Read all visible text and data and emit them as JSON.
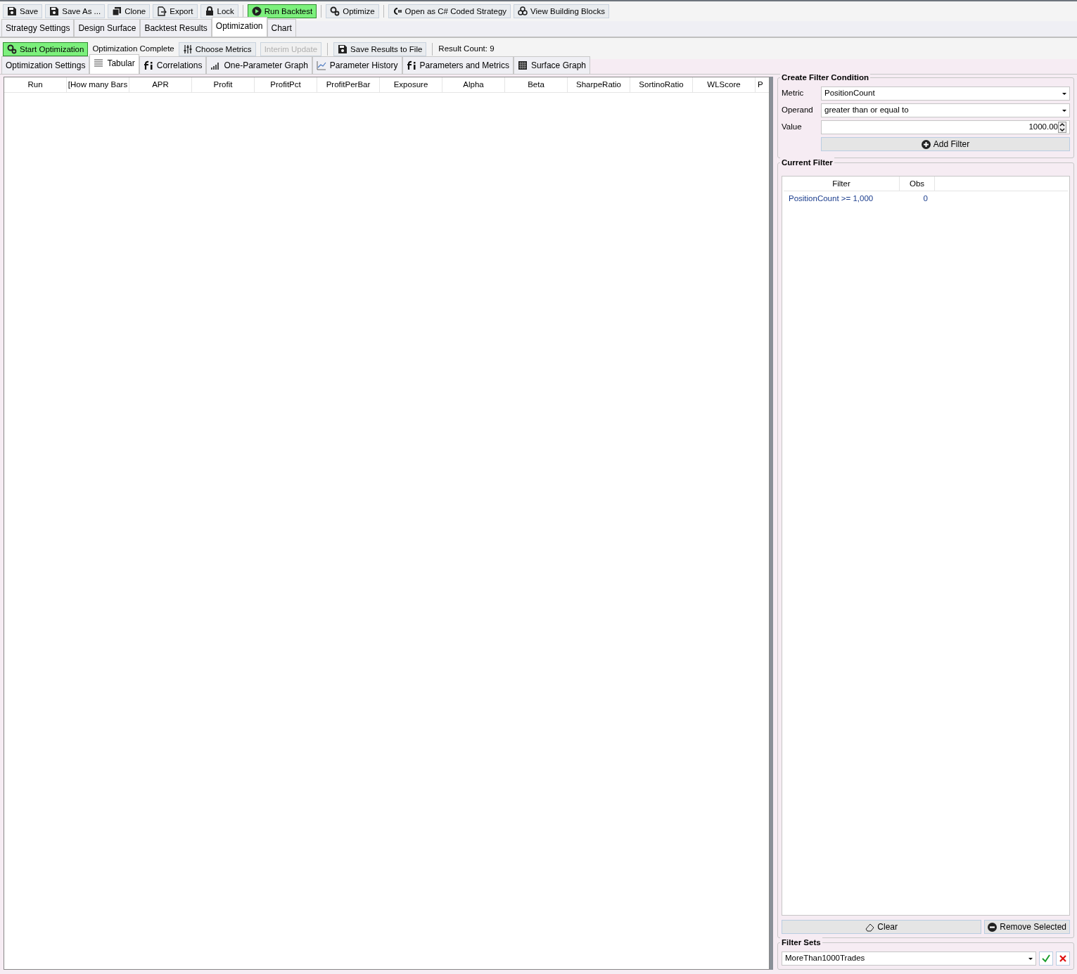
{
  "toolbar": [
    {
      "label": "Save",
      "highlighted": false
    },
    {
      "label": "Save As ...",
      "highlighted": false
    },
    {
      "label": "Clone",
      "highlighted": false
    },
    {
      "label": "Export",
      "highlighted": false
    },
    {
      "label": "Lock",
      "highlighted": false
    },
    {
      "label": "Run Backtest",
      "highlighted": true
    },
    {
      "label": "Optimize",
      "highlighted": false
    },
    {
      "label": "Open as C# Coded Strategy",
      "highlighted": false
    },
    {
      "label": "View Building Blocks",
      "highlighted": false
    }
  ],
  "main_tabs": [
    {
      "label": "Strategy Settings",
      "selected": false
    },
    {
      "label": "Design Surface",
      "selected": false
    },
    {
      "label": "Backtest Results",
      "selected": false
    },
    {
      "label": "Optimization",
      "selected": true
    },
    {
      "label": "Chart",
      "selected": false
    }
  ],
  "optimization_toolbar": {
    "start_button": {
      "label": "Start Optimization",
      "highlighted": true
    },
    "status": "Optimization Complete",
    "buttons": [
      {
        "label": "Choose Metrics",
        "disabled": false
      },
      {
        "label": "Interim Update",
        "disabled": true
      },
      {
        "label": "Save Results to File",
        "disabled": false
      }
    ],
    "result_count": "Result Count: 9"
  },
  "sub_tabs": [
    {
      "label": "Optimization Settings",
      "selected": false
    },
    {
      "label": "Tabular",
      "selected": true
    },
    {
      "label": "Correlations",
      "selected": false
    },
    {
      "label": "One-Parameter Graph",
      "selected": false
    },
    {
      "label": "Parameter History",
      "selected": false
    },
    {
      "label": "Parameters and Metrics",
      "selected": false
    },
    {
      "label": "Surface Graph",
      "selected": false
    }
  ],
  "results_table": {
    "columns": [
      "Run",
      "[How many Bars",
      "APR",
      "Profit",
      "ProfitPct",
      "ProfitPerBar",
      "Exposure",
      "Alpha",
      "Beta",
      "SharpeRatio",
      "SortinoRatio",
      "WLScore",
      "P"
    ]
  },
  "create_filter": {
    "title": "Create Filter Condition",
    "metric": {
      "label": "Metric",
      "value": "PositionCount"
    },
    "operand": {
      "label": "Operand",
      "value": "greater than or equal to"
    },
    "value": {
      "label": "Value",
      "value": "1000.00"
    },
    "add_button": "Add Filter"
  },
  "current_filter": {
    "title": "Current Filter",
    "columns": [
      "Filter",
      "Obs"
    ],
    "rows": [
      {
        "filter": "PositionCount >= 1,000",
        "obs": "0"
      }
    ],
    "clear_button": "Clear",
    "remove_button": "Remove Selected"
  },
  "filter_sets": {
    "title": "Filter Sets",
    "value": "MoreThan1000Trades"
  }
}
